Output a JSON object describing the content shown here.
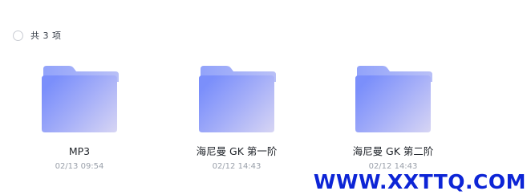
{
  "header": {
    "item_count_label": "共 3 项"
  },
  "files": [
    {
      "name": "MP3",
      "modified": "02/13 09:54",
      "icon": "folder-icon"
    },
    {
      "name": "海尼曼 GK 第一阶",
      "modified": "02/12 14:43",
      "icon": "folder-icon"
    },
    {
      "name": "海尼曼 GK 第二阶",
      "modified": "02/12 14:43",
      "icon": "folder-icon"
    }
  ],
  "watermark": {
    "text": "WWW.XXTTQ.COM"
  },
  "colors": {
    "folder_back": "#9aa9f8",
    "folder_front_start": "#7f93fb",
    "folder_front_end": "#d3d1f4",
    "watermark": "#0d25d6"
  }
}
